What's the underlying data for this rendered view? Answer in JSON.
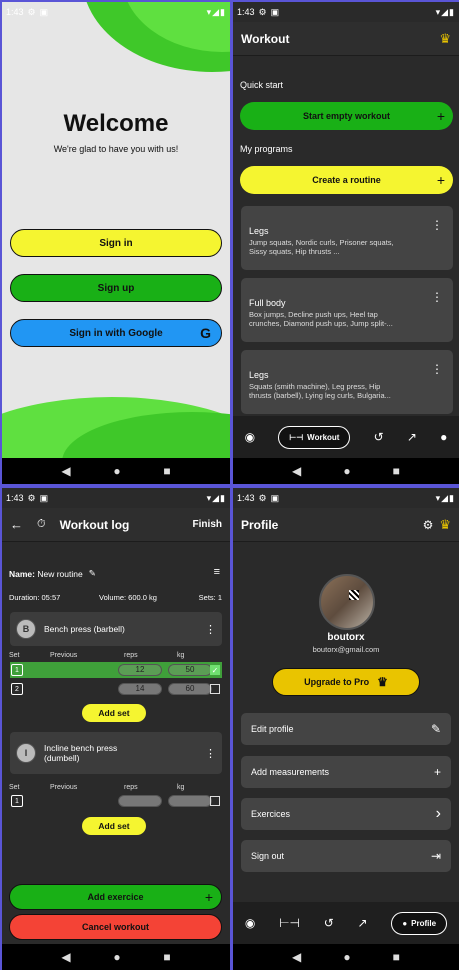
{
  "status": {
    "time": "1:43"
  },
  "welcome": {
    "title": "Welcome",
    "subtitle": "We're glad to have you with us!",
    "sign_in": "Sign in",
    "sign_up": "Sign up",
    "google": "Sign in with Google",
    "google_icon": "G"
  },
  "workout": {
    "title": "Workout",
    "quick_start": "Quick start",
    "start_empty": "Start empty workout",
    "my_programs": "My programs",
    "create_routine": "Create a routine",
    "routines": [
      {
        "name": "Legs",
        "desc": "Jump squats, Nordic curls, Prisoner squats, Sissy squats, Hip thrusts ..."
      },
      {
        "name": "Full body",
        "desc": "Box jumps, Decline push ups, Heel tap crunches, Diamond push ups, Jump split-..."
      },
      {
        "name": "Legs",
        "desc": "Squats (smith machine), Leg press, Hip thrusts (barbell), Lying leg curls, Bulgaria..."
      }
    ],
    "nav_active": "Workout"
  },
  "log": {
    "title": "Workout log",
    "finish": "Finish",
    "name_label": "Name:",
    "name_value": "New routine",
    "duration": "Duration: 05:57",
    "volume": "Volume: 600.0 kg",
    "sets": "Sets: 1",
    "exercises": [
      {
        "initial": "B",
        "name": "Bench press (barbell)"
      },
      {
        "initial": "I",
        "name": "Incline bench press (dumbell)"
      }
    ],
    "headers": {
      "set": "Set",
      "previous": "Previous",
      "reps": "reps",
      "kg": "kg"
    },
    "rows1": [
      {
        "set": "1",
        "reps": "12",
        "kg": "50"
      },
      {
        "set": "2",
        "reps": "14",
        "kg": "60"
      }
    ],
    "rows2": [
      {
        "set": "1",
        "reps": "",
        "kg": ""
      }
    ],
    "add_set": "Add set",
    "add_exercice": "Add exercice",
    "cancel": "Cancel workout"
  },
  "profile": {
    "title": "Profile",
    "username": "boutorx",
    "email": "boutorx@gmail.com",
    "upgrade": "Upgrade to Pro",
    "items": [
      {
        "label": "Edit profile",
        "icon": "✎"
      },
      {
        "label": "Add measurements",
        "icon": "+"
      },
      {
        "label": "Exercices",
        "icon": "›"
      },
      {
        "label": "Sign out",
        "icon": "⇥"
      }
    ],
    "nav_active": "Profile"
  },
  "colors": {
    "green": "#19b016",
    "yellow": "#f5f530",
    "blue": "#2196f3",
    "red": "#f44336",
    "gold": "#e9c400"
  }
}
